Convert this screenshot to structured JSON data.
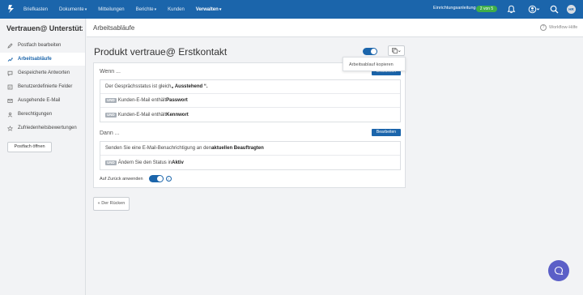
{
  "topbar": {
    "logo_icon": "app-logo-icon",
    "nav": [
      {
        "label": "Briefkasten",
        "caret": false,
        "bold": false
      },
      {
        "label": "Dokumente",
        "caret": true,
        "bold": false
      },
      {
        "label": "Mitteilungen",
        "caret": false,
        "bold": false
      },
      {
        "label": "Berichte",
        "caret": true,
        "bold": false
      },
      {
        "label": "Kunden",
        "caret": false,
        "bold": false
      },
      {
        "label": "Verwalten",
        "caret": true,
        "bold": true
      }
    ],
    "setup_label": "Einrichtungsanleitung",
    "setup_progress": "2 von 5",
    "avatar_initials": "HR",
    "accent": "#1b65ab",
    "badge_color": "#3fae49"
  },
  "sidebar": {
    "mailbox_title": "Vertrauen@ Unterstütz...",
    "items": [
      {
        "label": "Postfach bearbeiten",
        "icon": "pencil-icon",
        "active": false
      },
      {
        "label": "Arbeitsabläufe",
        "icon": "workflow-icon",
        "active": true
      },
      {
        "label": "Gespeicherte Antworten",
        "icon": "saved-replies-icon",
        "active": false
      },
      {
        "label": "Benutzerdefinierte Felder",
        "icon": "custom-fields-icon",
        "active": false
      },
      {
        "label": "Ausgehende E-Mail",
        "icon": "outgoing-mail-icon",
        "active": false
      },
      {
        "label": "Berechtigungen",
        "icon": "permissions-icon",
        "active": false
      },
      {
        "label": "Zufriedenheitsbewertungen",
        "icon": "ratings-icon",
        "active": false
      }
    ],
    "open_mailbox_label": "Postfach öffnen"
  },
  "header": {
    "breadcrumb": "Arbeitsabläufe",
    "help_label": "Workflow-Hilfe"
  },
  "workflow": {
    "title": "Produkt vertraue@ Erstkontakt",
    "enabled": true,
    "copy_menu_item": "Arbeitsablauf kopieren",
    "when_label": "Wenn ...",
    "edit_label": "Bearbeiten",
    "conditions": [
      {
        "prefix": "",
        "text": "Der Gesprächsstatus ist gleich ",
        "bold": "„ Ausstehend “."
      },
      {
        "prefix": "UND",
        "text": "Kunden-E-Mail enthält ",
        "bold": "Passwort"
      },
      {
        "prefix": "UND",
        "text": "Kunden-E-Mail enthält ",
        "bold": "Kennwort"
      }
    ],
    "then_label": "Dann ...",
    "actions": [
      {
        "prefix": "",
        "text": "Senden Sie eine E-Mail-Benachrichtigung an den ",
        "bold": "aktuellen Beauftragten"
      },
      {
        "prefix": "UND",
        "text": "Ändern Sie den Status in ",
        "bold": "Aktiv"
      }
    ],
    "apply_reverse_label": "Auf Zurück anwenden",
    "apply_reverse_on": true
  },
  "back_label": "« Der Rücken"
}
